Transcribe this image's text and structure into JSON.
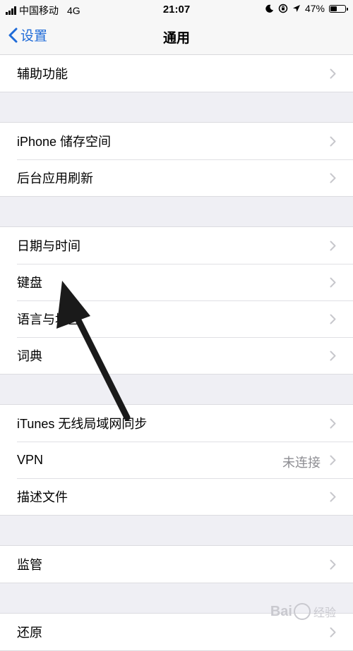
{
  "status_bar": {
    "carrier": "中国移动",
    "network": "4G",
    "time": "21:07",
    "battery_text": "47%",
    "battery_level": 0.47
  },
  "nav": {
    "back_label": "设置",
    "title": "通用"
  },
  "groups": [
    [
      {
        "label": "辅助功能",
        "detail": ""
      }
    ],
    [
      {
        "label": "iPhone 储存空间",
        "detail": ""
      },
      {
        "label": "后台应用刷新",
        "detail": ""
      }
    ],
    [
      {
        "label": "日期与时间",
        "detail": ""
      },
      {
        "label": "键盘",
        "detail": ""
      },
      {
        "label": "语言与地区",
        "detail": ""
      },
      {
        "label": "词典",
        "detail": ""
      }
    ],
    [
      {
        "label": "iTunes 无线局域网同步",
        "detail": ""
      },
      {
        "label": "VPN",
        "detail": "未连接"
      },
      {
        "label": "描述文件",
        "detail": ""
      }
    ],
    [
      {
        "label": "监管",
        "detail": ""
      }
    ],
    [
      {
        "label": "还原",
        "detail": ""
      }
    ]
  ],
  "colors": {
    "accent": "#1f6bd8",
    "background": "#efeff4",
    "detail_text": "#8e8e93"
  },
  "watermark": {
    "brand": "Bai",
    "suffix": "经验"
  }
}
